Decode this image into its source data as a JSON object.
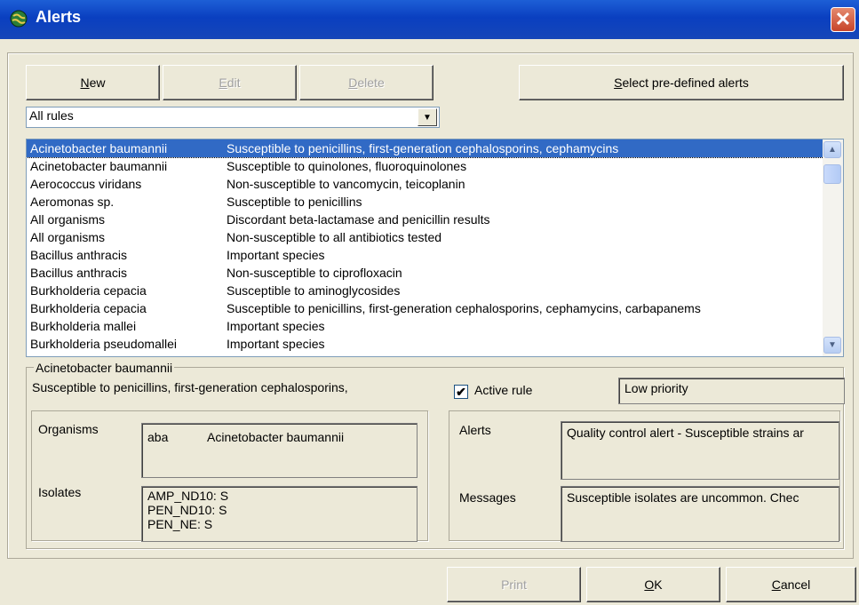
{
  "window": {
    "title": "Alerts"
  },
  "toolbar": {
    "new_label": "New",
    "edit_label": "Edit",
    "delete_label": "Delete",
    "predefined_label": "Select pre-defined alerts"
  },
  "filter": {
    "selected": "All rules"
  },
  "rules": [
    {
      "organism": "Acinetobacter baumannii",
      "rule": "Susceptible to penicillins, first-generation cephalosporins, cephamycins",
      "selected": true
    },
    {
      "organism": "Acinetobacter baumannii",
      "rule": "Susceptible to quinolones, fluoroquinolones"
    },
    {
      "organism": "Aerococcus viridans",
      "rule": "Non-susceptible to vancomycin, teicoplanin"
    },
    {
      "organism": "Aeromonas sp.",
      "rule": "Susceptible to penicillins"
    },
    {
      "organism": "All organisms",
      "rule": "Discordant beta-lactamase and penicillin results"
    },
    {
      "organism": "All organisms",
      "rule": "Non-susceptible to all antibiotics tested"
    },
    {
      "organism": "Bacillus anthracis",
      "rule": "Important species"
    },
    {
      "organism": "Bacillus anthracis",
      "rule": "Non-susceptible to ciprofloxacin"
    },
    {
      "organism": "Burkholderia cepacia",
      "rule": "Susceptible to aminoglycosides"
    },
    {
      "organism": "Burkholderia cepacia",
      "rule": "Susceptible to penicillins, first-generation cephalosporins, cephamycins, carbapanems"
    },
    {
      "organism": "Burkholderia mallei",
      "rule": "Important species"
    },
    {
      "organism": "Burkholderia pseudomallei",
      "rule": "Important species"
    }
  ],
  "detail": {
    "organism_title": "Acinetobacter baumannii",
    "rule_desc": "Susceptible to penicillins, first-generation cephalosporins,",
    "active_label": "Active rule",
    "active_checked": true,
    "priority": "Low priority",
    "organisms_label": "Organisms",
    "organism_code": "aba",
    "organism_name": "Acinetobacter baumannii",
    "isolates_label": "Isolates",
    "isolates": [
      "AMP_ND10:  S",
      "PEN_ND10:  S",
      "PEN_NE:  S"
    ],
    "alerts_label": "Alerts",
    "alerts_text": "Quality control alert - Susceptible strains ar",
    "messages_label": "Messages",
    "messages_text": "Susceptible isolates are uncommon.  Chec"
  },
  "footer": {
    "print_label": "Print",
    "ok_label": "OK",
    "cancel_label": "Cancel"
  }
}
